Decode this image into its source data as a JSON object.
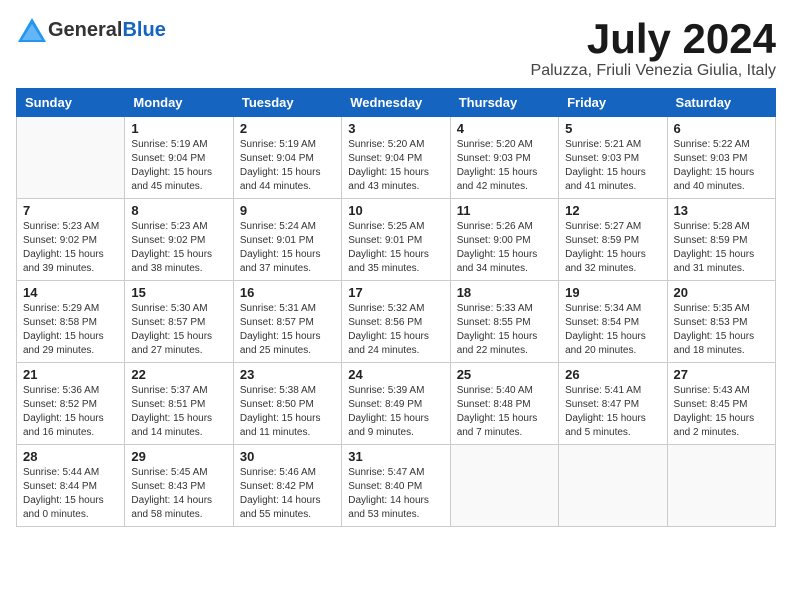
{
  "header": {
    "logo_general": "General",
    "logo_blue": "Blue",
    "month": "July 2024",
    "location": "Paluzza, Friuli Venezia Giulia, Italy"
  },
  "weekdays": [
    "Sunday",
    "Monday",
    "Tuesday",
    "Wednesday",
    "Thursday",
    "Friday",
    "Saturday"
  ],
  "weeks": [
    [
      {
        "day": "",
        "info": ""
      },
      {
        "day": "1",
        "info": "Sunrise: 5:19 AM\nSunset: 9:04 PM\nDaylight: 15 hours\nand 45 minutes."
      },
      {
        "day": "2",
        "info": "Sunrise: 5:19 AM\nSunset: 9:04 PM\nDaylight: 15 hours\nand 44 minutes."
      },
      {
        "day": "3",
        "info": "Sunrise: 5:20 AM\nSunset: 9:04 PM\nDaylight: 15 hours\nand 43 minutes."
      },
      {
        "day": "4",
        "info": "Sunrise: 5:20 AM\nSunset: 9:03 PM\nDaylight: 15 hours\nand 42 minutes."
      },
      {
        "day": "5",
        "info": "Sunrise: 5:21 AM\nSunset: 9:03 PM\nDaylight: 15 hours\nand 41 minutes."
      },
      {
        "day": "6",
        "info": "Sunrise: 5:22 AM\nSunset: 9:03 PM\nDaylight: 15 hours\nand 40 minutes."
      }
    ],
    [
      {
        "day": "7",
        "info": "Sunrise: 5:23 AM\nSunset: 9:02 PM\nDaylight: 15 hours\nand 39 minutes."
      },
      {
        "day": "8",
        "info": "Sunrise: 5:23 AM\nSunset: 9:02 PM\nDaylight: 15 hours\nand 38 minutes."
      },
      {
        "day": "9",
        "info": "Sunrise: 5:24 AM\nSunset: 9:01 PM\nDaylight: 15 hours\nand 37 minutes."
      },
      {
        "day": "10",
        "info": "Sunrise: 5:25 AM\nSunset: 9:01 PM\nDaylight: 15 hours\nand 35 minutes."
      },
      {
        "day": "11",
        "info": "Sunrise: 5:26 AM\nSunset: 9:00 PM\nDaylight: 15 hours\nand 34 minutes."
      },
      {
        "day": "12",
        "info": "Sunrise: 5:27 AM\nSunset: 8:59 PM\nDaylight: 15 hours\nand 32 minutes."
      },
      {
        "day": "13",
        "info": "Sunrise: 5:28 AM\nSunset: 8:59 PM\nDaylight: 15 hours\nand 31 minutes."
      }
    ],
    [
      {
        "day": "14",
        "info": "Sunrise: 5:29 AM\nSunset: 8:58 PM\nDaylight: 15 hours\nand 29 minutes."
      },
      {
        "day": "15",
        "info": "Sunrise: 5:30 AM\nSunset: 8:57 PM\nDaylight: 15 hours\nand 27 minutes."
      },
      {
        "day": "16",
        "info": "Sunrise: 5:31 AM\nSunset: 8:57 PM\nDaylight: 15 hours\nand 25 minutes."
      },
      {
        "day": "17",
        "info": "Sunrise: 5:32 AM\nSunset: 8:56 PM\nDaylight: 15 hours\nand 24 minutes."
      },
      {
        "day": "18",
        "info": "Sunrise: 5:33 AM\nSunset: 8:55 PM\nDaylight: 15 hours\nand 22 minutes."
      },
      {
        "day": "19",
        "info": "Sunrise: 5:34 AM\nSunset: 8:54 PM\nDaylight: 15 hours\nand 20 minutes."
      },
      {
        "day": "20",
        "info": "Sunrise: 5:35 AM\nSunset: 8:53 PM\nDaylight: 15 hours\nand 18 minutes."
      }
    ],
    [
      {
        "day": "21",
        "info": "Sunrise: 5:36 AM\nSunset: 8:52 PM\nDaylight: 15 hours\nand 16 minutes."
      },
      {
        "day": "22",
        "info": "Sunrise: 5:37 AM\nSunset: 8:51 PM\nDaylight: 15 hours\nand 14 minutes."
      },
      {
        "day": "23",
        "info": "Sunrise: 5:38 AM\nSunset: 8:50 PM\nDaylight: 15 hours\nand 11 minutes."
      },
      {
        "day": "24",
        "info": "Sunrise: 5:39 AM\nSunset: 8:49 PM\nDaylight: 15 hours\nand 9 minutes."
      },
      {
        "day": "25",
        "info": "Sunrise: 5:40 AM\nSunset: 8:48 PM\nDaylight: 15 hours\nand 7 minutes."
      },
      {
        "day": "26",
        "info": "Sunrise: 5:41 AM\nSunset: 8:47 PM\nDaylight: 15 hours\nand 5 minutes."
      },
      {
        "day": "27",
        "info": "Sunrise: 5:43 AM\nSunset: 8:45 PM\nDaylight: 15 hours\nand 2 minutes."
      }
    ],
    [
      {
        "day": "28",
        "info": "Sunrise: 5:44 AM\nSunset: 8:44 PM\nDaylight: 15 hours\nand 0 minutes."
      },
      {
        "day": "29",
        "info": "Sunrise: 5:45 AM\nSunset: 8:43 PM\nDaylight: 14 hours\nand 58 minutes."
      },
      {
        "day": "30",
        "info": "Sunrise: 5:46 AM\nSunset: 8:42 PM\nDaylight: 14 hours\nand 55 minutes."
      },
      {
        "day": "31",
        "info": "Sunrise: 5:47 AM\nSunset: 8:40 PM\nDaylight: 14 hours\nand 53 minutes."
      },
      {
        "day": "",
        "info": ""
      },
      {
        "day": "",
        "info": ""
      },
      {
        "day": "",
        "info": ""
      }
    ]
  ]
}
